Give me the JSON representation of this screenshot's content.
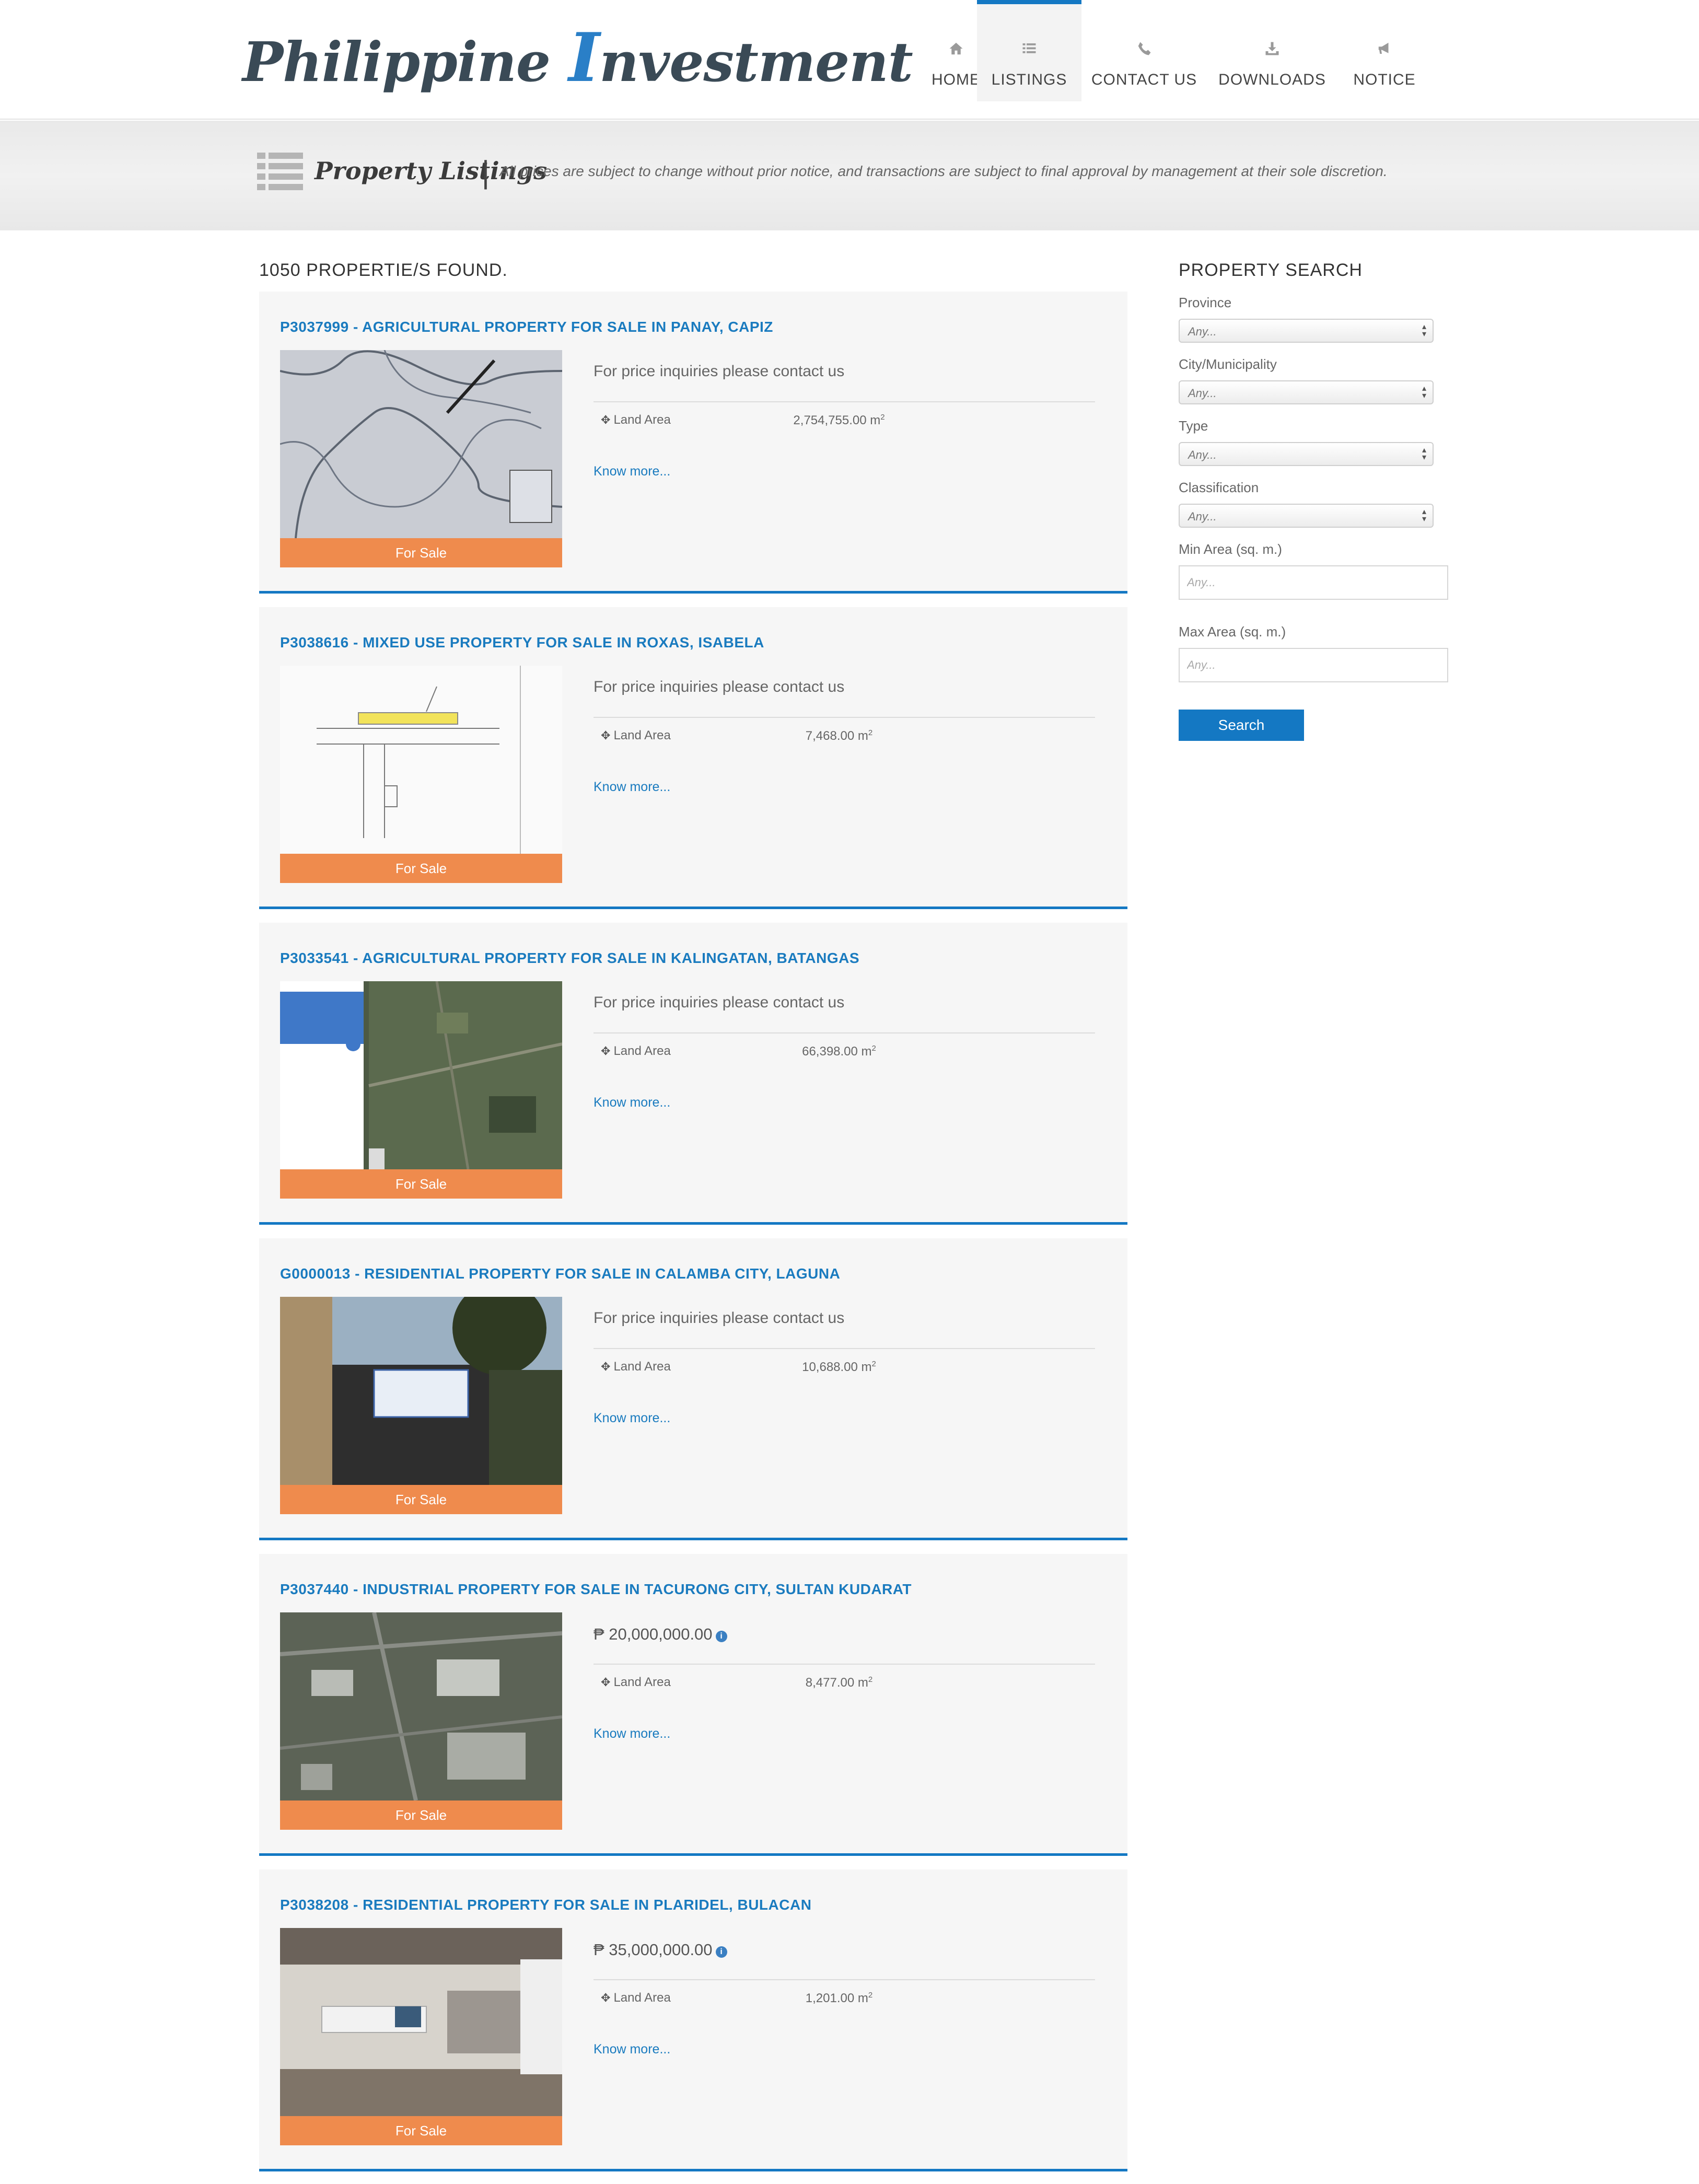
{
  "brand": {
    "logo_text_a": "Philippine",
    "logo_cap": "I",
    "logo_text_b": "nvestment"
  },
  "nav": [
    {
      "label": "HOME",
      "icon": "home-icon"
    },
    {
      "label": "LISTINGS",
      "icon": "list-icon",
      "active": true
    },
    {
      "label": "CONTACT US",
      "icon": "phone-icon"
    },
    {
      "label": "DOWNLOADS",
      "icon": "download-icon"
    },
    {
      "label": "NOTICE",
      "icon": "megaphone-icon"
    }
  ],
  "banner": {
    "title": "Property Listings",
    "separator": "|",
    "note": "All prices are subject to change without prior notice, and transactions are subject to final approval by management at their sole discretion."
  },
  "results": {
    "count_text": "1050 PROPERTIE/S FOUND.",
    "listings": [
      {
        "title": "P3037999 - AGRICULTURAL PROPERTY FOR SALE IN PANAY, CAPIZ",
        "price": "For price inquiries please contact us",
        "area_label": "Land Area",
        "area_value": "2,754,755.00 m",
        "area_unit_sup": "2",
        "link": "Know more...",
        "badge": "For Sale"
      },
      {
        "title": "P3038616 - MIXED USE PROPERTY FOR SALE IN ROXAS, ISABELA",
        "price": "For price inquiries please contact us",
        "area_label": "Land Area",
        "area_value": "7,468.00 m",
        "area_unit_sup": "2",
        "link": "Know more...",
        "badge": "For Sale"
      },
      {
        "title": "P3033541 - AGRICULTURAL PROPERTY FOR SALE IN KALINGATAN, BATANGAS",
        "price": "For price inquiries please contact us",
        "area_label": "Land Area",
        "area_value": "66,398.00 m",
        "area_unit_sup": "2",
        "link": "Know more...",
        "badge": "For Sale"
      },
      {
        "title": "G0000013 - RESIDENTIAL PROPERTY FOR SALE IN CALAMBA CITY, LAGUNA",
        "price": "For price inquiries please contact us",
        "area_label": "Land Area",
        "area_value": "10,688.00 m",
        "area_unit_sup": "2",
        "link": "Know more...",
        "badge": "For Sale"
      },
      {
        "title": "P3037440 - INDUSTRIAL PROPERTY FOR SALE IN TACURONG CITY, SULTAN KUDARAT",
        "price": "₱ 20,000,000.00",
        "area_label": "Land Area",
        "area_value": "8,477.00 m",
        "area_unit_sup": "2",
        "link": "Know more...",
        "badge": "For Sale"
      },
      {
        "title": "P3038208 - RESIDENTIAL PROPERTY FOR SALE IN PLARIDEL, BULACAN",
        "price": "₱ 35,000,000.00",
        "area_label": "Land Area",
        "area_value": "1,201.00 m",
        "area_unit_sup": "2",
        "link": "Know more...",
        "badge": "For Sale"
      }
    ]
  },
  "search": {
    "title": "PROPERTY SEARCH",
    "province": {
      "label": "Province",
      "value": "Any..."
    },
    "city": {
      "label": "City/Municipality",
      "value": "Any..."
    },
    "type": {
      "label": "Type",
      "value": "Any..."
    },
    "classification": {
      "label": "Classification",
      "value": "Any..."
    },
    "min_area": {
      "label": "Min Area (sq. m.)",
      "placeholder": "Any..."
    },
    "max_area": {
      "label": "Max Area (sq. m.)",
      "placeholder": "Any..."
    },
    "button_label": "Search"
  },
  "colors": {
    "accent": "#1478c3",
    "badge": "#ef8b4d",
    "card_bg": "#f6f6f6"
  }
}
